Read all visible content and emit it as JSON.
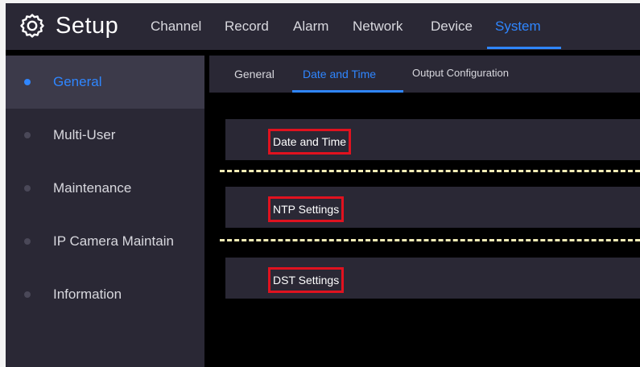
{
  "header": {
    "title": "Setup",
    "tabs": [
      {
        "label": "Channel"
      },
      {
        "label": "Record"
      },
      {
        "label": "Alarm"
      },
      {
        "label": "Network"
      },
      {
        "label": "Device"
      },
      {
        "label": "System"
      }
    ],
    "active_tab": "System"
  },
  "sidebar": {
    "items": [
      {
        "label": "General"
      },
      {
        "label": "Multi-User"
      },
      {
        "label": "Maintenance"
      },
      {
        "label": "IP Camera Maintain"
      },
      {
        "label": "Information"
      }
    ],
    "active_item": "General"
  },
  "subtabs": {
    "items": [
      {
        "label": "General"
      },
      {
        "label": "Date and Time"
      },
      {
        "label": "Output Configuration"
      }
    ],
    "active_item": "Date and Time"
  },
  "sections": [
    {
      "label": "Date and Time"
    },
    {
      "label": "NTP Settings"
    },
    {
      "label": "DST Settings"
    }
  ],
  "colors": {
    "accent": "#2f86ff",
    "panel": "#2a2835",
    "highlight_box": "#e0121f",
    "divider": "#f2ecb6"
  },
  "icons": {
    "setup": "gear-icon"
  }
}
